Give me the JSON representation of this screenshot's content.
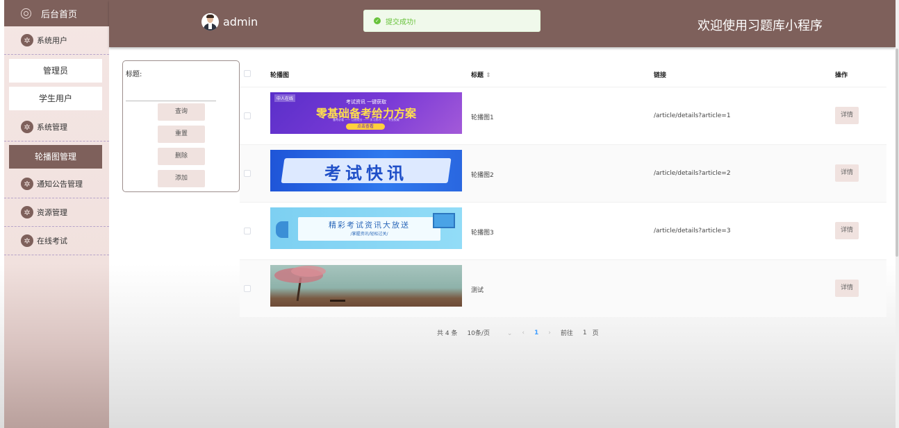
{
  "sidebar": {
    "home": "后台首页",
    "menus": [
      {
        "label": "系统用户",
        "items": [
          "管理员",
          "学生用户"
        ]
      },
      {
        "label": "系统管理",
        "items": [
          "轮播图管理"
        ]
      },
      {
        "label": "通知公告管理"
      },
      {
        "label": "资源管理"
      },
      {
        "label": "在线考试"
      }
    ]
  },
  "header": {
    "username": "admin",
    "welcome": "欢迎使用习题库小程序"
  },
  "toast": {
    "message": "提交成功!"
  },
  "search": {
    "title_label": "标题:",
    "query": "查询",
    "reset": "重置",
    "delete": "删除",
    "add": "添加"
  },
  "table": {
    "headers": {
      "image": "轮播图",
      "title": "标题",
      "link": "链接",
      "action": "操作"
    },
    "rows": [
      {
        "title": "轮播图1",
        "link": "/article/details?article=1",
        "action": "详情",
        "banner": {
          "top": "考试资讯 一键获取",
          "main": "零基础备考给力方案",
          "sub": "备考必看 —— 让经验分 —— 学习技巧 —— 专业权威",
          "cta": "点击查看",
          "logo": "中人在线"
        }
      },
      {
        "title": "轮播图2",
        "link": "/article/details?article=2",
        "action": "详情",
        "banner": {
          "main": "考试快讯"
        }
      },
      {
        "title": "轮播图3",
        "link": "/article/details?article=3",
        "action": "详情",
        "banner": {
          "main": "精彩考试资讯大放送",
          "sub": "/掌握资讯/轻松过关/"
        }
      },
      {
        "title": "测试",
        "link": "",
        "action": "详情"
      }
    ]
  },
  "pagination": {
    "total": "共 4 条",
    "page_size": "10条/页",
    "current": "1",
    "goto": "前往",
    "page_num": "1",
    "page_unit": "页"
  }
}
